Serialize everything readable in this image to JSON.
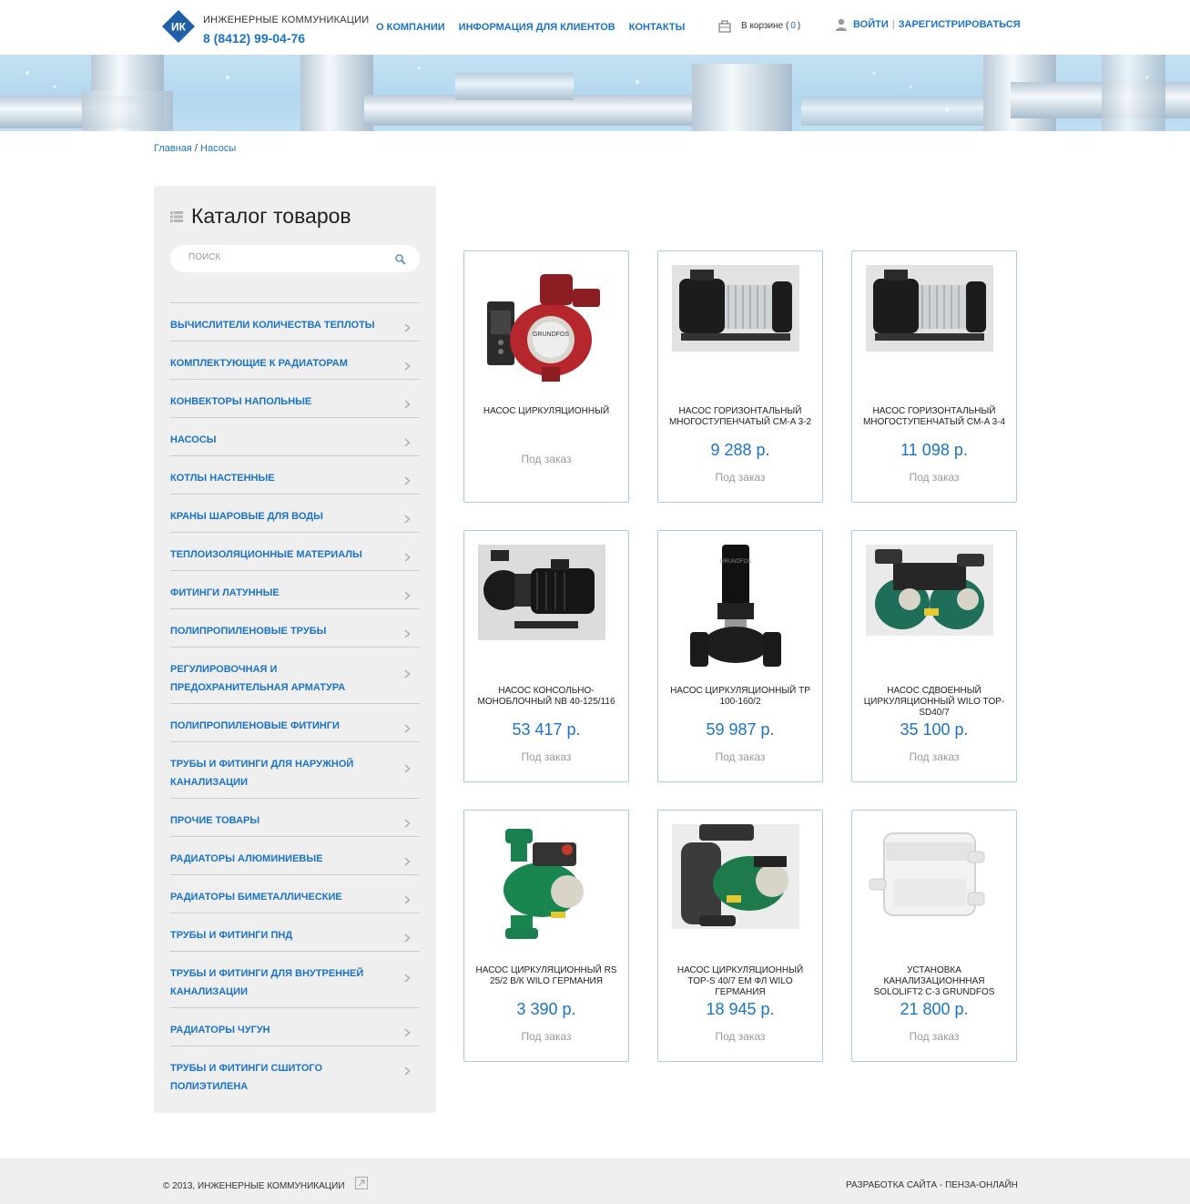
{
  "header": {
    "company": "Инженерные коммуникации",
    "phone": "8 (8412) 99-04-76",
    "logo_text": "ИК",
    "nav": [
      "О компании",
      "Информация для клиентов",
      "Контакты"
    ],
    "cart_label": "В корзине",
    "cart_open": "(",
    "cart_count": "0",
    "cart_close": ")",
    "login": "Войти",
    "divider": "|",
    "register": "Зарегистрироваться"
  },
  "breadcrumb": {
    "home": "Главная",
    "separator": " / ",
    "current": "Насосы"
  },
  "sidebar": {
    "title": "Каталог товаров",
    "search_placeholder": "ПОИСК",
    "categories": [
      "Вычислители количества теплоты",
      "Комплектующие к радиаторам",
      "Конвекторы напольные",
      "Насосы",
      "Котлы настенные",
      "Краны шаровые для воды",
      "Теплоизоляционные материалы",
      "Фитинги латунные",
      "Полипропиленовые трубы",
      "Регулировочная и предохранительная арматура",
      "Полипропиленовые фитинги",
      "Трубы и фитинги для наружной канализации",
      "Прочие товары",
      "Радиаторы алюминиевые",
      "Радиаторы биметаллические",
      "Трубы и фитинги ПНД",
      "Трубы и фитинги для внутренней канализации",
      "Радиаторы чугун",
      "Трубы и фитинги сшитого полиэтилена"
    ]
  },
  "products": [
    {
      "name": "Насос циркуляционный",
      "price": "",
      "status": "Под заказ",
      "icon": "red-circulation-pump"
    },
    {
      "name": "Насос горизонтальный многоступенчатый CM-A 3-2",
      "price": "9 288 р.",
      "status": "Под заказ",
      "icon": "horizontal-multistage-pump"
    },
    {
      "name": "Насос горизонтальный многоступенчатый CM-A 3-4",
      "price": "11 098 р.",
      "status": "Под заказ",
      "icon": "horizontal-multistage-pump"
    },
    {
      "name": "Насос консольно-моноблочный NB 40-125/116",
      "price": "53 417 р.",
      "status": "Под заказ",
      "icon": "monoblock-pump"
    },
    {
      "name": "Насос циркуляционный TP 100-160/2",
      "price": "59 987 р.",
      "status": "Под заказ",
      "icon": "inline-vertical-pump"
    },
    {
      "name": "Насос сдвоенный циркуляционный Wilo TOP-SD40/7",
      "price": "35 100 р.",
      "status": "Под заказ",
      "icon": "twin-pump"
    },
    {
      "name": "Насос циркуляционный RS 25/2 В/К Wilo Германия",
      "price": "3 390 р.",
      "status": "Под заказ",
      "icon": "green-circulation-pump"
    },
    {
      "name": "Насос циркуляционный TOP-S 40/7 EM фл Wilo Германия",
      "price": "18 945 р.",
      "status": "Под заказ",
      "icon": "flanged-circulation-pump"
    },
    {
      "name": "Установка канализационнная Sololift2 C-3 Grundfos",
      "price": "21 800 р.",
      "status": "Под заказ",
      "icon": "sewage-lifting-unit"
    }
  ],
  "footer": {
    "copyright": "© 2013, Инженерные коммуникации",
    "developer": "Разработка сайта - Пенза-Онлайн"
  },
  "colors": {
    "accent": "#1a73c8",
    "card_border": "#a9cde6",
    "sidebar_bg": "#efefef"
  }
}
